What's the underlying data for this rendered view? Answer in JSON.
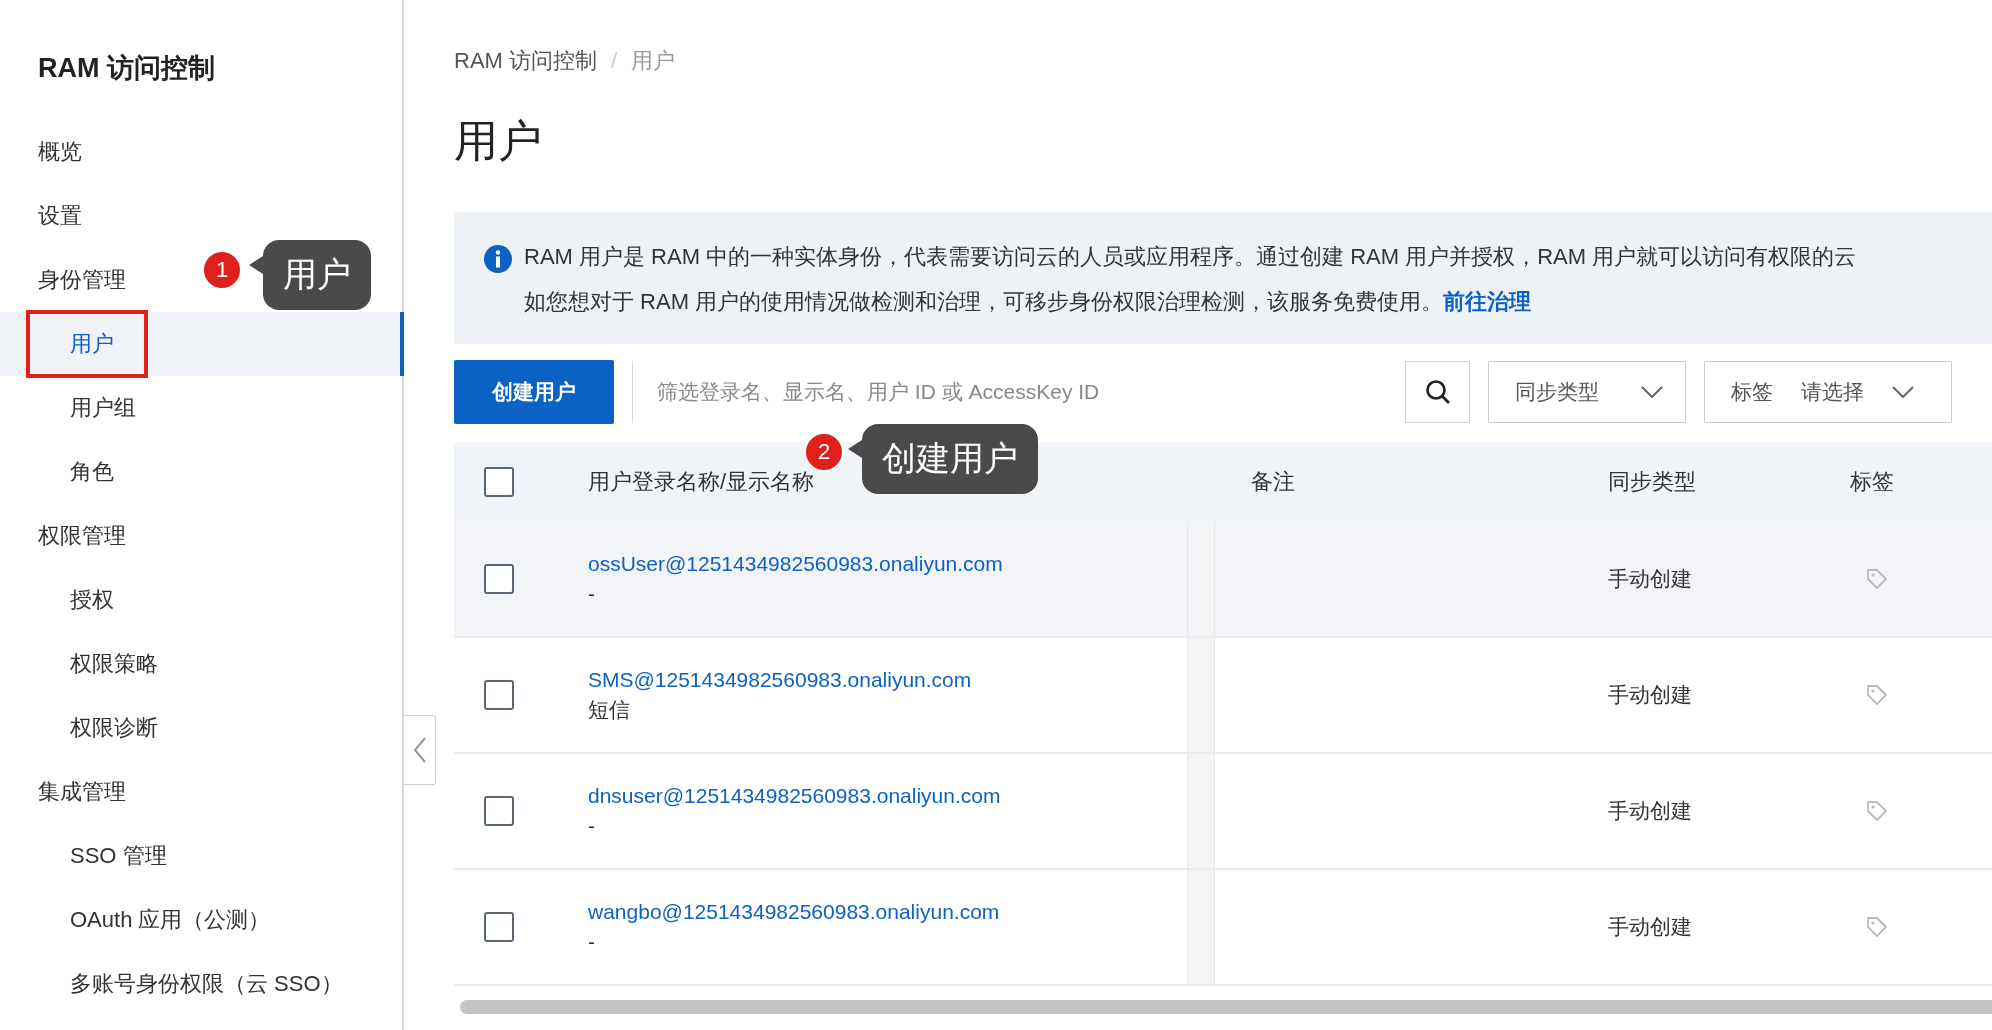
{
  "sidebar": {
    "title": "RAM 访问控制",
    "items": [
      {
        "label": "概览",
        "selected": false
      },
      {
        "label": "设置",
        "selected": false
      },
      {
        "label": "身份管理",
        "selected": false,
        "children": [
          {
            "label": "用户",
            "selected": true
          },
          {
            "label": "用户组",
            "selected": false
          },
          {
            "label": "角色",
            "selected": false
          }
        ]
      },
      {
        "label": "权限管理",
        "selected": false,
        "children": [
          {
            "label": "授权",
            "selected": false
          },
          {
            "label": "权限策略",
            "selected": false
          },
          {
            "label": "权限诊断",
            "selected": false
          }
        ]
      },
      {
        "label": "集成管理",
        "selected": false,
        "children": [
          {
            "label": "SSO 管理",
            "selected": false
          },
          {
            "label": "OAuth 应用（公测）",
            "selected": false
          },
          {
            "label": "多账号身份权限（云 SSO）",
            "selected": false
          }
        ]
      }
    ]
  },
  "breadcrumb": [
    "RAM 访问控制",
    "用户"
  ],
  "breadcrumb_separator": "/",
  "page_title": "用户",
  "notice": {
    "lines": [
      "RAM 用户是 RAM 中的一种实体身份，代表需要访问云的人员或应用程序。通过创建 RAM 用户并授权，RAM 用户就可以访问有权限的云",
      "如您想对于 RAM 用户的使用情况做检测和治理，可移步身份权限治理检测，该服务免费使用。"
    ],
    "link": "前往治理"
  },
  "toolbar": {
    "create_button": "创建用户",
    "search": {
      "placeholder": "筛选登录名、显示名、用户 ID 或 AccessKey ID"
    },
    "filters": [
      {
        "label": "同步类型"
      },
      {
        "label": "标签",
        "placeholder": "请选择"
      }
    ]
  },
  "table": {
    "select_all_checked": false,
    "columns": [
      "用户登录名称/显示名称",
      "备注",
      "同步类型",
      "标签"
    ],
    "rows": [
      {
        "login_name": "ossUser@1251434982560983.onaliyun.com",
        "display_name": "-",
        "sync_type": "手动创建",
        "checked": false,
        "hovered": true
      },
      {
        "login_name": "SMS@1251434982560983.onaliyun.com",
        "display_name": "短信",
        "sync_type": "手动创建",
        "checked": false,
        "hovered": false
      },
      {
        "login_name": "dnsuser@1251434982560983.onaliyun.com",
        "display_name": "-",
        "sync_type": "手动创建",
        "checked": false,
        "hovered": false
      },
      {
        "login_name": "wangbo@1251434982560983.onaliyun.com",
        "display_name": "-",
        "sync_type": "手动创建",
        "checked": false,
        "hovered": false
      }
    ]
  },
  "annotations": [
    {
      "number": "1",
      "label": "用户"
    },
    {
      "number": "2",
      "label": "创建用户"
    }
  ]
}
